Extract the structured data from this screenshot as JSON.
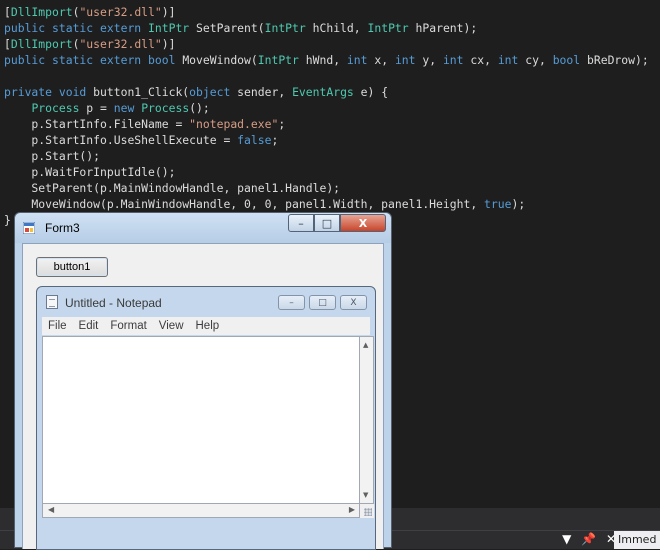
{
  "code": {
    "lines": [
      [
        {
          "t": "[",
          "c": "p"
        },
        {
          "t": "DllImport",
          "c": "ty"
        },
        {
          "t": "(",
          "c": "p"
        },
        {
          "t": "\"user32.dll\"",
          "c": "st"
        },
        {
          "t": ")]",
          "c": "p"
        }
      ],
      [
        {
          "t": "public static extern ",
          "c": "kw"
        },
        {
          "t": "IntPtr",
          "c": "ty"
        },
        {
          "t": " SetParent(",
          "c": "p"
        },
        {
          "t": "IntPtr",
          "c": "ty"
        },
        {
          "t": " hChild, ",
          "c": "p"
        },
        {
          "t": "IntPtr",
          "c": "ty"
        },
        {
          "t": " hParent);",
          "c": "p"
        }
      ],
      [
        {
          "t": "[",
          "c": "p"
        },
        {
          "t": "DllImport",
          "c": "ty"
        },
        {
          "t": "(",
          "c": "p"
        },
        {
          "t": "\"user32.dll\"",
          "c": "st"
        },
        {
          "t": ")]",
          "c": "p"
        }
      ],
      [
        {
          "t": "public static extern bool ",
          "c": "kw"
        },
        {
          "t": "MoveWindow(",
          "c": "p"
        },
        {
          "t": "IntPtr",
          "c": "ty"
        },
        {
          "t": " hWnd, ",
          "c": "p"
        },
        {
          "t": "int",
          "c": "kw"
        },
        {
          "t": " x, ",
          "c": "p"
        },
        {
          "t": "int",
          "c": "kw"
        },
        {
          "t": " y, ",
          "c": "p"
        },
        {
          "t": "int",
          "c": "kw"
        },
        {
          "t": " cx, ",
          "c": "p"
        },
        {
          "t": "int",
          "c": "kw"
        },
        {
          "t": " cy, ",
          "c": "p"
        },
        {
          "t": "bool",
          "c": "kw"
        },
        {
          "t": " bReDrow);",
          "c": "p"
        }
      ],
      [],
      [
        {
          "t": "private void ",
          "c": "kw"
        },
        {
          "t": "button1_Click(",
          "c": "p"
        },
        {
          "t": "object",
          "c": "kw"
        },
        {
          "t": " sender, ",
          "c": "p"
        },
        {
          "t": "EventArgs",
          "c": "ty"
        },
        {
          "t": " e) {",
          "c": "p"
        }
      ],
      [
        {
          "t": "    ",
          "c": "p"
        },
        {
          "t": "Process",
          "c": "ty"
        },
        {
          "t": " p = ",
          "c": "p"
        },
        {
          "t": "new ",
          "c": "kw"
        },
        {
          "t": "Process",
          "c": "ty"
        },
        {
          "t": "();",
          "c": "p"
        }
      ],
      [
        {
          "t": "    p.StartInfo.FileName = ",
          "c": "p"
        },
        {
          "t": "\"notepad.exe\"",
          "c": "st"
        },
        {
          "t": ";",
          "c": "p"
        }
      ],
      [
        {
          "t": "    p.StartInfo.UseShellExecute = ",
          "c": "p"
        },
        {
          "t": "false",
          "c": "kw"
        },
        {
          "t": ";",
          "c": "p"
        }
      ],
      [
        {
          "t": "    p.Start();",
          "c": "p"
        }
      ],
      [
        {
          "t": "    p.WaitForInputIdle();",
          "c": "p"
        }
      ],
      [
        {
          "t": "    SetParent(p.MainWindowHandle, panel1.Handle);",
          "c": "p"
        }
      ],
      [
        {
          "t": "    MoveWindow(p.MainWindowHandle, 0, 0, panel1.Width, panel1.Height, ",
          "c": "p"
        },
        {
          "t": "true",
          "c": "kw"
        },
        {
          "t": ");",
          "c": "p"
        }
      ],
      [
        {
          "t": "}",
          "c": "p"
        }
      ]
    ]
  },
  "form": {
    "title": "Form3",
    "button_label": "button1",
    "controls": {
      "min": "–",
      "max": "□",
      "close": "X"
    }
  },
  "notepad": {
    "title": "Untitled - Notepad",
    "menu": [
      "File",
      "Edit",
      "Format",
      "View",
      "Help"
    ],
    "controls": {
      "min": "–",
      "max": "□",
      "close": "X"
    }
  },
  "statusbar": {
    "tools": [
      "▼",
      "📌",
      "✕"
    ],
    "immediate_label": "Immed"
  },
  "colors": {
    "editor_bg": "#1e1e1e",
    "keyword": "#569cd6",
    "type": "#4ec9b0",
    "string": "#d69d85"
  }
}
